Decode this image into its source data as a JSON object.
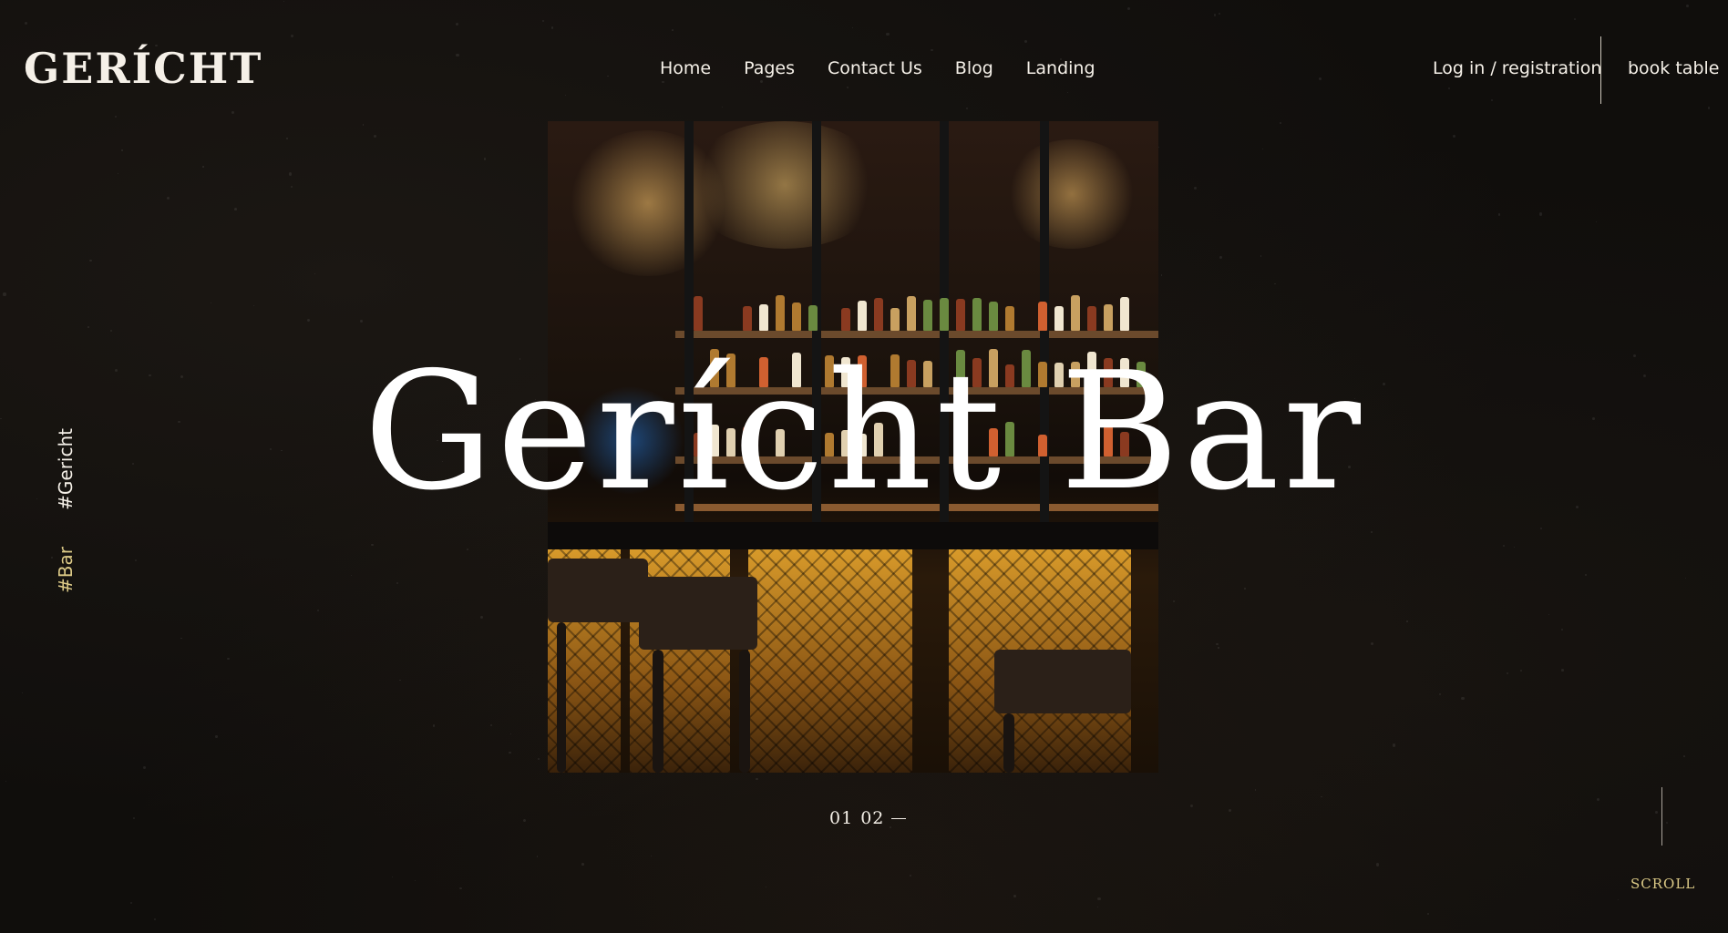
{
  "brand": {
    "logo": "GERÍCHT"
  },
  "nav": {
    "items": [
      "Home",
      "Pages",
      "Contact Us",
      "Blog",
      "Landing"
    ]
  },
  "header": {
    "auth_label": "Log in / registration",
    "book_label": "book table"
  },
  "side_tags": {
    "first": "#Gericht",
    "second": "#Bar"
  },
  "hero": {
    "title": "Gerícht Bar",
    "image": "bar-interior-photo"
  },
  "slider": {
    "current": "01",
    "next": "02"
  },
  "scroll_label": "SCROLL",
  "colors": {
    "background": "#100e0c",
    "accent": "#DCCA87",
    "text": "#ffffff"
  }
}
